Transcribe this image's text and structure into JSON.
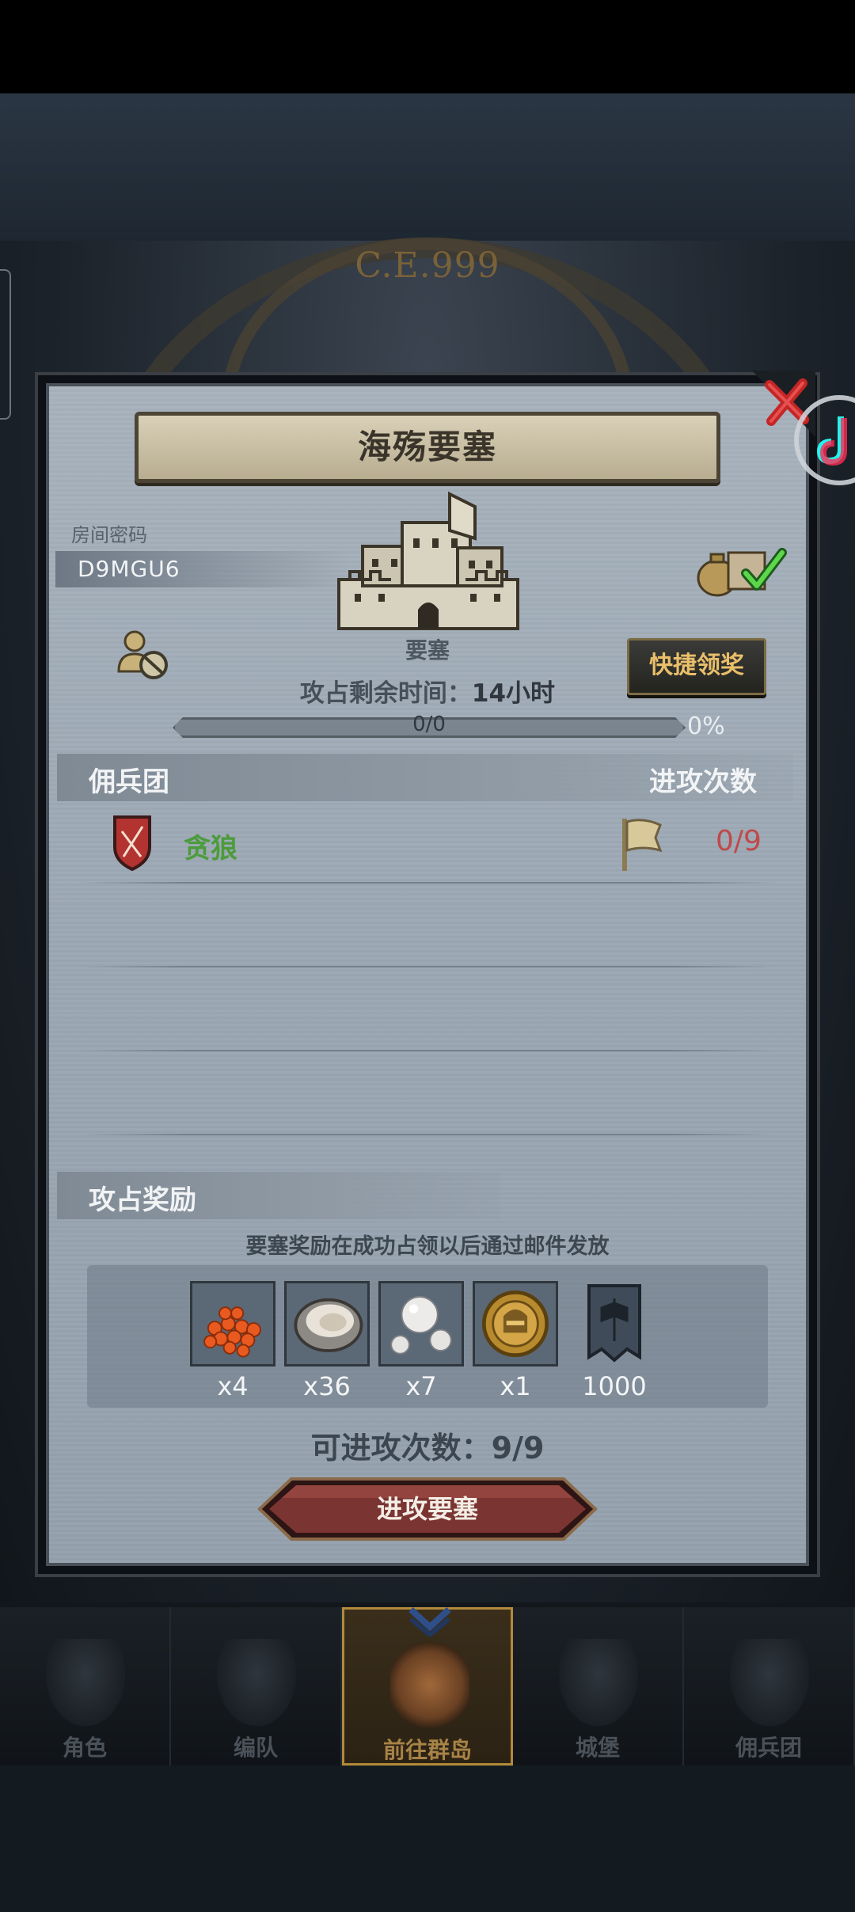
{
  "background": {
    "era_text": "C.E.999"
  },
  "modal": {
    "title": "海殇要塞",
    "room_label": "房间密码",
    "room_code": "D9MGU6",
    "fortress_label": "要塞",
    "quick_claim_label": "快捷领奖",
    "timer_label": "攻占剩余时间：",
    "timer_value": "14小时",
    "progress_text": "0/0",
    "progress_percent_text": "0%",
    "progress_fraction": 0,
    "mercenary_header": "佣兵团",
    "attack_count_header": "进攻次数",
    "mercenaries": [
      {
        "name": "贪狼",
        "attacks": "0/9",
        "name_color": "#4c9b3c",
        "count_color": "#bf4a4a"
      }
    ],
    "reward_header": "攻占奖励",
    "reward_note": "要塞奖励在成功占领以后通过邮件发放",
    "rewards": [
      {
        "icon": "roe-icon",
        "qty": "x4"
      },
      {
        "icon": "oyster-icon",
        "qty": "x36"
      },
      {
        "icon": "pearl-icon",
        "qty": "x7"
      },
      {
        "icon": "knight-coin-icon",
        "qty": "x1"
      },
      {
        "icon": "banner-icon",
        "qty": "1000"
      }
    ],
    "available_attacks_label": "可进攻次数：",
    "available_attacks_value": "9/9",
    "attack_button_label": "进攻要塞"
  },
  "nav": {
    "items": [
      {
        "label": "角色",
        "icon": "character-icon",
        "active": false
      },
      {
        "label": "编队",
        "icon": "formation-icon",
        "active": false
      },
      {
        "label": "前往群岛",
        "icon": "islands-icon",
        "active": true
      },
      {
        "label": "城堡",
        "icon": "castle-icon",
        "active": false
      },
      {
        "label": "佣兵团",
        "icon": "mercenary-icon",
        "active": false
      }
    ]
  },
  "colors": {
    "modal_bg": "#a1acb8",
    "accent_gold": "#e9bf6a",
    "attack_button": "#7a3432",
    "merc_name": "#4c9b3c",
    "attack_count": "#bf4a4a"
  }
}
